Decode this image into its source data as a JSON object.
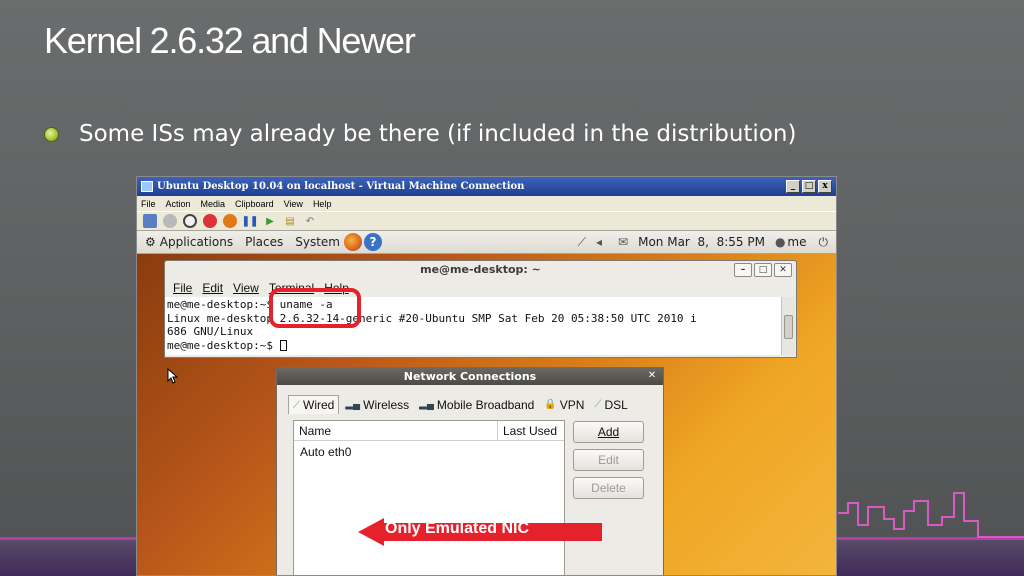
{
  "slide": {
    "title": "Kernel 2.6.32 and Newer",
    "bullet": "Some ISs may already be there (if included in the distribution)"
  },
  "vm_window": {
    "title": "Ubuntu Desktop 10.04 on localhost - Virtual Machine Connection",
    "menu": [
      "File",
      "Action",
      "Media",
      "Clipboard",
      "View",
      "Help"
    ],
    "controls": [
      "_",
      "□",
      "x"
    ]
  },
  "ubuntu_panel": {
    "menus": [
      "Applications",
      "Places",
      "System"
    ],
    "clock": "Mon Mar  8,  8:55 PM",
    "user": "me"
  },
  "terminal": {
    "title": "me@me-desktop: ~",
    "menu": [
      "File",
      "Edit",
      "View",
      "Terminal",
      "Help"
    ],
    "lines": [
      "me@me-desktop:~$ uname -a",
      "Linux me-desktop 2.6.32-14-generic #20-Ubuntu SMP Sat Feb 20 05:38:50 UTC 2010 i",
      "686 GNU/Linux",
      "me@me-desktop:~$ "
    ]
  },
  "network_dialog": {
    "title": "Network Connections",
    "tabs": [
      "Wired",
      "Wireless",
      "Mobile Broadband",
      "VPN",
      "DSL"
    ],
    "active_tab": "Wired",
    "columns": [
      "Name",
      "Last Used"
    ],
    "rows": [
      {
        "name": "Auto eth0",
        "last_used": ""
      }
    ],
    "buttons": {
      "add": "Add",
      "edit": "Edit",
      "delete": "Delete"
    }
  },
  "annotation": {
    "arrow_label": "Only Emulated NIC"
  },
  "colors": {
    "accent_red": "#e5212c",
    "bottom_line": "#b83ca6",
    "vm_title_blue": "#1f3f91"
  }
}
